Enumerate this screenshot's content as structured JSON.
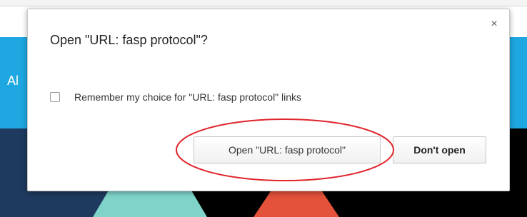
{
  "background": {
    "fragment_text": "Al"
  },
  "dialog": {
    "title": "Open \"URL: fasp protocol\"?",
    "close_glyph": "×",
    "remember_label": "Remember my choice for \"URL: fasp protocol\" links",
    "remember_checked": false,
    "open_button_label": "Open \"URL: fasp protocol\"",
    "dont_open_button_label": "Don't open"
  },
  "annotation": {
    "shape": "ellipse",
    "target": "open_button",
    "color": "#e0242a"
  }
}
